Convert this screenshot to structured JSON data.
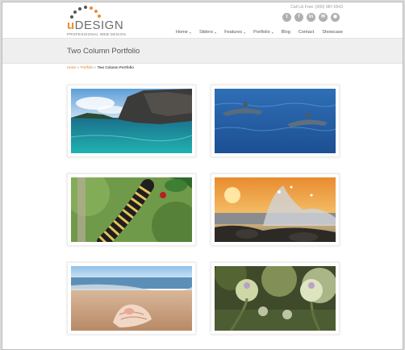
{
  "brand": {
    "name_prefix": "u",
    "name_rest": "DESIGN",
    "tagline": "PROFESSIONAL WEB DESIGN"
  },
  "topbar": {
    "call_us": "Call Us Free: (000) 987-6543",
    "socials": [
      {
        "icon": "twitter-icon",
        "glyph": "t"
      },
      {
        "icon": "facebook-icon",
        "glyph": "f"
      },
      {
        "icon": "linkedin-icon",
        "glyph": "in"
      },
      {
        "icon": "email-icon",
        "glyph": "✉"
      },
      {
        "icon": "rss-icon",
        "glyph": "◉"
      }
    ]
  },
  "nav": [
    {
      "label": "Home",
      "has_submenu": true
    },
    {
      "label": "Sliders",
      "has_submenu": true
    },
    {
      "label": "Features",
      "has_submenu": true
    },
    {
      "label": "Portfolio",
      "has_submenu": true
    },
    {
      "label": "Blog",
      "has_submenu": false
    },
    {
      "label": "Contact",
      "has_submenu": false
    },
    {
      "label": "Showcase",
      "has_submenu": false
    }
  ],
  "page": {
    "title": "Two Column Portfolio",
    "breadcrumb": {
      "home": "Home",
      "sep": "»",
      "portfolio": "Portfolio",
      "current": "Two Column Portfolio"
    }
  },
  "portfolio": [
    {
      "name": "coastal-cliff"
    },
    {
      "name": "dolphins"
    },
    {
      "name": "caterpillar"
    },
    {
      "name": "sunset-wave"
    },
    {
      "name": "beach-shell"
    },
    {
      "name": "green-buds"
    }
  ],
  "colors": {
    "accent": "#e8902a",
    "link": "#e0802a",
    "band": "#efefef"
  }
}
